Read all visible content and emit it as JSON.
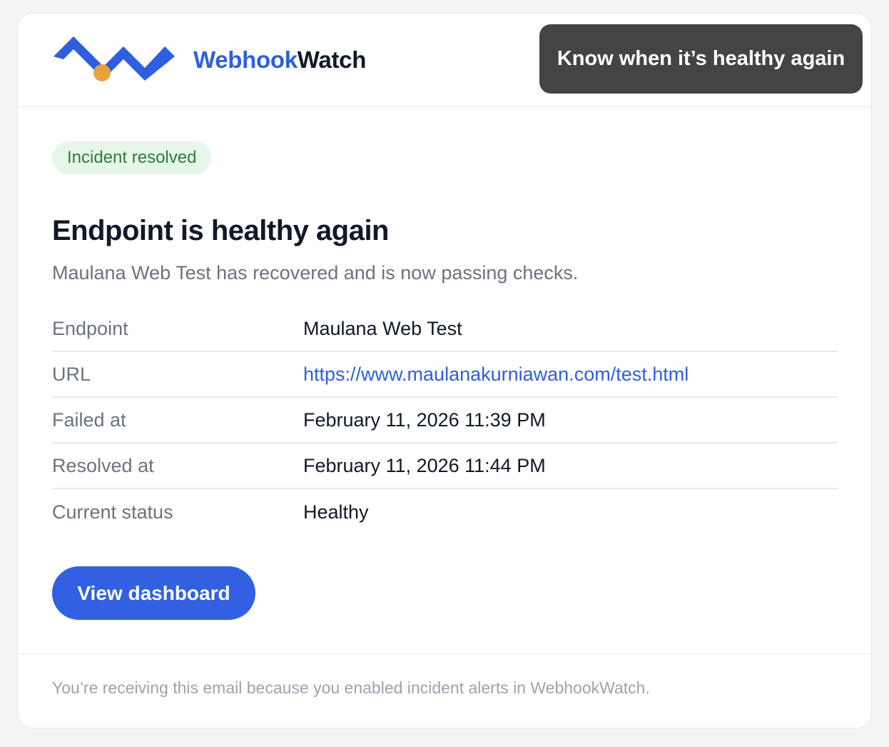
{
  "header": {
    "brand_accent": "Webhook",
    "brand_rest": "Watch",
    "tooltip": "Know when it’s healthy again"
  },
  "badge": "Incident resolved",
  "title": "Endpoint is healthy again",
  "subtitle": "Maulana Web Test has recovered and is now passing checks.",
  "details": [
    {
      "label": "Endpoint",
      "value": "Maulana Web Test"
    },
    {
      "label": "URL",
      "value": "https://www.maulanakurniawan.com/test.html"
    },
    {
      "label": "Failed at",
      "value": "February 11, 2026 11:39 PM"
    },
    {
      "label": "Resolved at",
      "value": "February 11, 2026 11:44 PM"
    },
    {
      "label": "Current status",
      "value": "Healthy"
    }
  ],
  "cta_label": "View dashboard",
  "footer_text": "You’re receiving this email because you enabled incident alerts in WebhookWatch.",
  "colors": {
    "brand_blue": "#2f5ee0",
    "logo_orange": "#e9a23b",
    "badge_bg": "#e6f6ea",
    "badge_text": "#2e7d3b"
  },
  "icons": {
    "logo": "webhookwatch-wave-logo"
  }
}
